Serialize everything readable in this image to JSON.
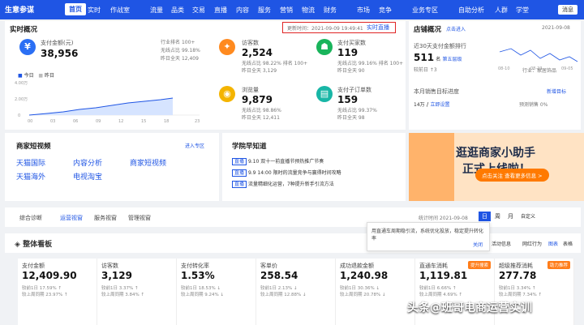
{
  "topbar": {
    "brand": "生意参谋",
    "nav": [
      "首页",
      "实时",
      "作战室",
      "流量",
      "品类",
      "交易",
      "直播",
      "内容",
      "服务",
      "营销",
      "物流",
      "财务",
      "市场",
      "竞争",
      "业务专区",
      "自助分析",
      "人群",
      "学堂"
    ],
    "messages": "消息"
  },
  "realtime": {
    "title": "实时概况",
    "updated": "更新时间：2021-09-09 19:49:41",
    "live_link": "实时直播",
    "pay_label": "支付金额(元)",
    "pay_value": "38,956",
    "compare": [
      {
        "label": "行业排名",
        "value": "100+"
      },
      {
        "label": "无线占比",
        "value": "99.18%"
      },
      {
        "label": "昨日全天",
        "value": "12,409"
      }
    ],
    "legend_today": "今日",
    "legend_yesterday": "昨日",
    "axis_y": [
      "4.00万",
      "2.00万",
      "0"
    ],
    "axis_x": [
      "00",
      "03",
      "06",
      "09",
      "12",
      "15",
      "18",
      "23"
    ],
    "metrics": [
      {
        "label": "访客数",
        "value": "2,524",
        "r1": "无线占比 98.22%",
        "r1b": "排名 100+",
        "r2": "昨日全天 3,129"
      },
      {
        "label": "支付买家数",
        "value": "119",
        "r1": "无线占比 99.16%",
        "r1b": "排名 100+",
        "r2": "昨日全天 90"
      },
      {
        "label": "浏览量",
        "value": "9,879",
        "r1": "无线占比 98.86%",
        "r1b": "",
        "r2": "昨日全天 12,411"
      },
      {
        "label": "支付子订单数",
        "value": "159",
        "r1": "无线占比 99.37%",
        "r1b": "",
        "r2": "昨日全天 98"
      }
    ]
  },
  "store": {
    "title": "店铺概况",
    "more": "点击进入",
    "date": "2021-09-08",
    "rank_label": "近30天支付金额排行",
    "rank_value": "511",
    "rank_unit": "名",
    "rank_level": "第五层级",
    "rank_note": "较前日 ↑3",
    "industry": "行业：家居饰品",
    "chart_x": [
      "08-10",
      "08-23",
      "09-05"
    ],
    "growth_title": "本月销售目标进度",
    "growth_link": "新增目标",
    "growth_value": "14万",
    "growth_action": "立即设置",
    "growth_done": "预测销售 0%"
  },
  "video": {
    "title": "商家短视频",
    "link": "进入专区",
    "items": [
      "天猫国际",
      "内容分析",
      "商家短视频",
      "天猫海外",
      "电视淘宝"
    ]
  },
  "academy": {
    "title": "学院早知道",
    "items": [
      {
        "tag": "直播",
        "text": "9.10 双十一前直播节预热推广节奏"
      },
      {
        "tag": "直播",
        "text": "9.9 14:00 限时的流量竞争与赢得时间攻略"
      },
      {
        "tag": "直播",
        "text": "流量精细化运营，7种提升新手引流方法"
      }
    ]
  },
  "ad": {
    "line1": "逛逛商家小助手",
    "line2": "正式上线啦！",
    "cta": "点击关注 查看更多信息 >"
  },
  "tabs": [
    "综合诊断",
    "运营视窗",
    "服务视窗",
    "管理视窗"
  ],
  "time_bar": {
    "stat_time": "统计时间 2021-09-08",
    "units": [
      "日",
      "周",
      "月",
      "自定义"
    ]
  },
  "overview": {
    "title": "整体看板",
    "right_links": [
      "活动信息",
      "网红行为",
      "图表",
      "表格"
    ]
  },
  "tooltip": {
    "text": "用直通车周期稳引流，系统优化投放，稳定提升转化率",
    "close": "关闭"
  },
  "stats": [
    {
      "title": "支付金额",
      "value": "12,409.90",
      "a": "较前1日  17.59% ↑",
      "b": "较上周同期  23.97% ↑"
    },
    {
      "title": "访客数",
      "value": "3,129",
      "a": "较前1日  3.37% ↑",
      "b": "较上周同期  3.84% ↑"
    },
    {
      "title": "支付转化率",
      "value": "1.53%",
      "a": "较前1日  18.53% ↓",
      "b": "较上周同期  9.24% ↓"
    },
    {
      "title": "客单价",
      "value": "258.54",
      "a": "较前1日  2.13% ↓",
      "b": "较上周同期  12.88% ↓"
    },
    {
      "title": "成功退款金额",
      "value": "1,240.98",
      "a": "较前1日  30.36% ↓",
      "b": "较上周同期  20.78% ↓"
    },
    {
      "title": "直通车消耗",
      "value": "1,119.81",
      "a": "较前1日  6.66% ↑",
      "b": "较上周同期  4.69% ↑",
      "tag": "提升搜索"
    },
    {
      "title": "超级推荐消耗",
      "value": "277.78",
      "a": "较前1日  3.34% ↑",
      "b": "较上周同期  7.34% ↑",
      "tag": "助力推荐"
    }
  ],
  "watermark": "头条@班哥电商运营实训"
}
